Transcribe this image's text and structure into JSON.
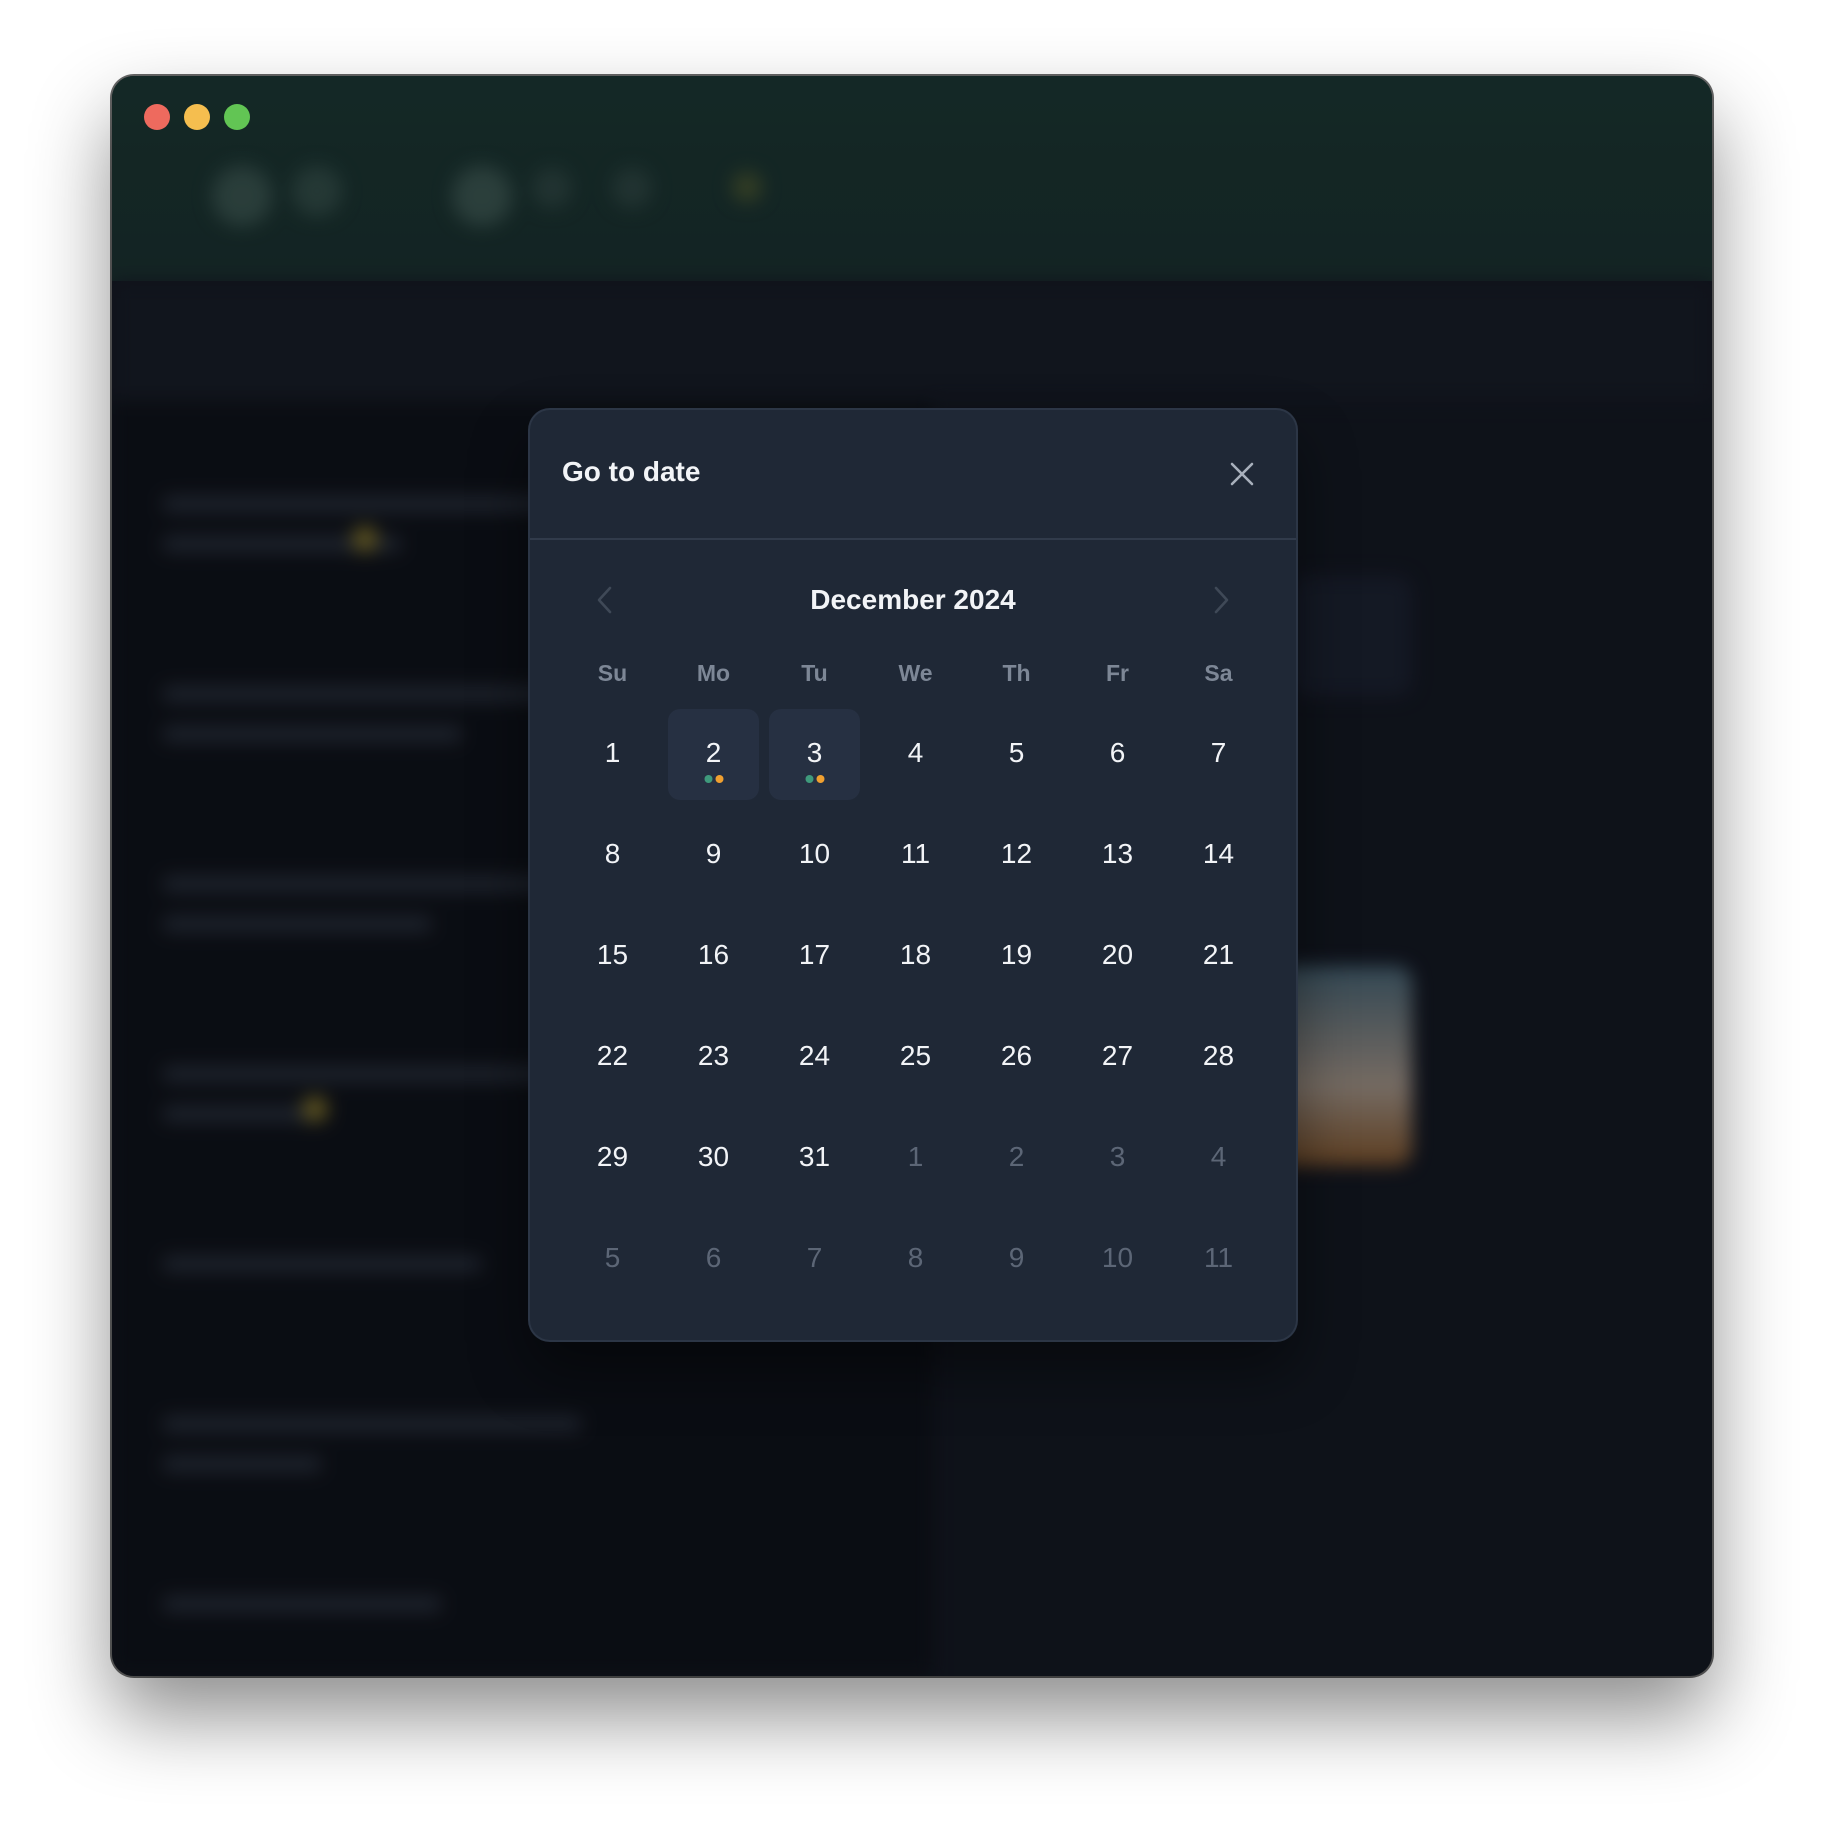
{
  "dialog": {
    "title": "Go to date",
    "month_label": "December 2024",
    "weekdays": [
      "Su",
      "Mo",
      "Tu",
      "We",
      "Th",
      "Fr",
      "Sa"
    ],
    "days": [
      {
        "label": "1",
        "current": true
      },
      {
        "label": "2",
        "current": true,
        "has_events": true
      },
      {
        "label": "3",
        "current": true,
        "has_events": true
      },
      {
        "label": "4",
        "current": true
      },
      {
        "label": "5",
        "current": true
      },
      {
        "label": "6",
        "current": true
      },
      {
        "label": "7",
        "current": true
      },
      {
        "label": "8",
        "current": true
      },
      {
        "label": "9",
        "current": true
      },
      {
        "label": "10",
        "current": true
      },
      {
        "label": "11",
        "current": true
      },
      {
        "label": "12",
        "current": true
      },
      {
        "label": "13",
        "current": true
      },
      {
        "label": "14",
        "current": true
      },
      {
        "label": "15",
        "current": true
      },
      {
        "label": "16",
        "current": true
      },
      {
        "label": "17",
        "current": true
      },
      {
        "label": "18",
        "current": true
      },
      {
        "label": "19",
        "current": true
      },
      {
        "label": "20",
        "current": true
      },
      {
        "label": "21",
        "current": true
      },
      {
        "label": "22",
        "current": true
      },
      {
        "label": "23",
        "current": true
      },
      {
        "label": "24",
        "current": true
      },
      {
        "label": "25",
        "current": true
      },
      {
        "label": "26",
        "current": true
      },
      {
        "label": "27",
        "current": true
      },
      {
        "label": "28",
        "current": true
      },
      {
        "label": "29",
        "current": true
      },
      {
        "label": "30",
        "current": true
      },
      {
        "label": "31",
        "current": true
      },
      {
        "label": "1",
        "current": false
      },
      {
        "label": "2",
        "current": false
      },
      {
        "label": "3",
        "current": false
      },
      {
        "label": "4",
        "current": false
      },
      {
        "label": "5",
        "current": false
      },
      {
        "label": "6",
        "current": false
      },
      {
        "label": "7",
        "current": false
      },
      {
        "label": "8",
        "current": false
      },
      {
        "label": "9",
        "current": false
      },
      {
        "label": "10",
        "current": false
      },
      {
        "label": "11",
        "current": false
      }
    ],
    "event_dot_colors": [
      "#3f9a7c",
      "#f0a030"
    ]
  },
  "icons": {
    "close": "close-icon",
    "prev": "chevron-left-icon",
    "next": "chevron-right-icon"
  },
  "colors": {
    "titlebar": "#1b3a33",
    "dialog_bg": "#1f2836",
    "marked_day_bg": "#263042"
  }
}
